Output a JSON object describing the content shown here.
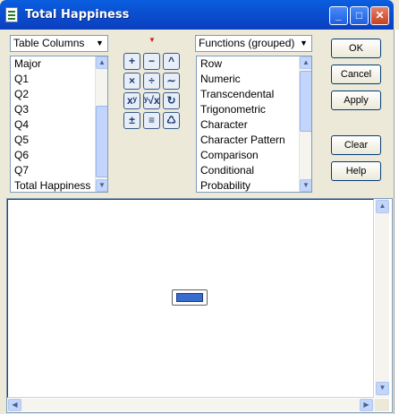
{
  "window": {
    "title": "Total Happiness"
  },
  "columns_combo": {
    "selected": "Table Columns"
  },
  "columns_list": {
    "items": [
      "Major",
      "Q1",
      "Q2",
      "Q3",
      "Q4",
      "Q5",
      "Q6",
      "Q7",
      "Total Happiness"
    ]
  },
  "functions_combo": {
    "selected": "Functions (grouped)"
  },
  "functions_list": {
    "items": [
      "Row",
      "Numeric",
      "Transcendental",
      "Trigonometric",
      "Character",
      "Character Pattern",
      "Comparison",
      "Conditional",
      "Probability"
    ]
  },
  "keypad": {
    "keys": [
      "+",
      "−",
      "^",
      "×",
      "÷",
      "∼",
      "xʸ",
      "ʸ√x",
      "↻",
      "±",
      "≡",
      "♺"
    ]
  },
  "buttons": {
    "ok": "OK",
    "cancel": "Cancel",
    "apply": "Apply",
    "clear": "Clear",
    "help": "Help"
  },
  "colors": {
    "titlebar": "#0a4fd0",
    "selected_box": "#3a6ccf"
  }
}
